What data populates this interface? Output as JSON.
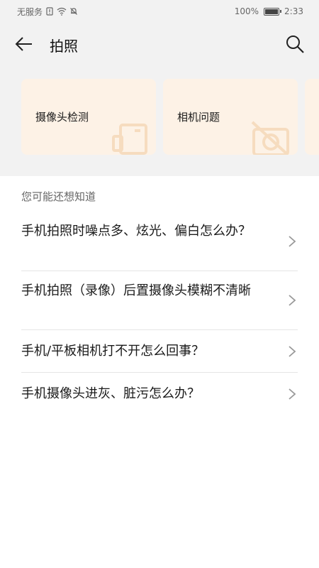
{
  "status_bar": {
    "carrier": "无服务",
    "battery_percent_label": "100%",
    "battery_level": 1.0,
    "time": "2:33"
  },
  "app_bar": {
    "title": "拍照",
    "back_icon": "arrow-left-icon",
    "search_icon": "search-icon"
  },
  "cards": [
    {
      "label": "摄像头检测",
      "icon": "camera-outline-icon"
    },
    {
      "label": "相机问题",
      "icon": "camera-off-icon"
    },
    {
      "label": "",
      "icon": ""
    }
  ],
  "suggestions": {
    "title": "您可能还想知道",
    "items": [
      {
        "text": "手机拍照时噪点多、炫光、偏白怎么办？"
      },
      {
        "text": "手机拍照（录像）后置摄像头模糊不清晰"
      },
      {
        "text": "手机/平板相机打不开怎么回事？"
      },
      {
        "text": "手机摄像头进灰、脏污怎么办？"
      }
    ]
  },
  "colors": {
    "card_bg": "#fdf2e6",
    "card_icon": "#f6dcbf",
    "band_bg": "#f2f2f2"
  }
}
